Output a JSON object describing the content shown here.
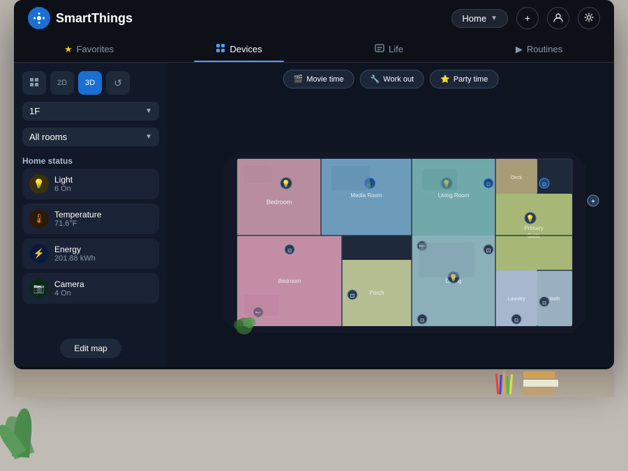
{
  "app": {
    "name": "SmartThings",
    "logo_symbol": "✦"
  },
  "header": {
    "home_label": "Home",
    "add_label": "+",
    "profile_icon": "👤",
    "settings_icon": "⚙"
  },
  "nav": {
    "tabs": [
      {
        "id": "favorites",
        "label": "Favorites",
        "icon": "★",
        "active": false
      },
      {
        "id": "devices",
        "label": "Devices",
        "icon": "⊞",
        "active": true
      },
      {
        "id": "life",
        "label": "Life",
        "icon": "☰",
        "active": false
      },
      {
        "id": "routines",
        "label": "Routines",
        "icon": "▶",
        "active": false
      }
    ]
  },
  "view_controls": {
    "grid_icon": "⊞",
    "label_2d": "2D",
    "label_3d": "3D",
    "history_icon": "↺"
  },
  "floor": {
    "current": "1F",
    "room": "All rooms"
  },
  "home_status": {
    "title": "Home status",
    "items": [
      {
        "id": "light",
        "label": "Light",
        "value": "6 On",
        "icon": "💡",
        "type": "light"
      },
      {
        "id": "temperature",
        "label": "Temperature",
        "value": "71.6°F",
        "icon": "🌡",
        "type": "temp"
      },
      {
        "id": "energy",
        "label": "Energy",
        "value": "201.88 kWh",
        "icon": "⚡",
        "type": "energy"
      },
      {
        "id": "camera",
        "label": "Camera",
        "value": "4 On",
        "icon": "📷",
        "type": "camera"
      }
    ]
  },
  "edit_map_label": "Edit map",
  "scenes": [
    {
      "id": "movie",
      "label": "Movie time",
      "icon": "🎬"
    },
    {
      "id": "workout",
      "label": "Work out",
      "icon": "🔧"
    },
    {
      "id": "party",
      "label": "Party time",
      "icon": "⭐"
    }
  ],
  "colors": {
    "bg_dark": "#0d1117",
    "sidebar_bg": "#111827",
    "accent_blue": "#1a6fd4",
    "active_tab_line": "#4a9eff"
  }
}
